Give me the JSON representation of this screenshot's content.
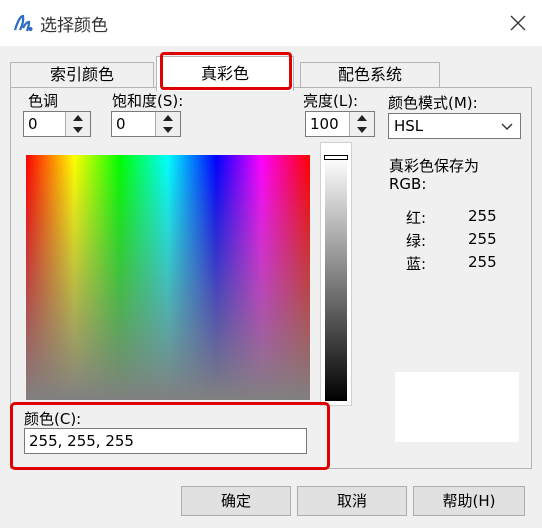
{
  "window": {
    "title": "选择颜色",
    "icon": "app-logo-icon",
    "close_icon": "close-icon"
  },
  "tabs": [
    {
      "label": "索引颜色"
    },
    {
      "label": "真彩色",
      "active": true
    },
    {
      "label": "配色系统"
    }
  ],
  "hsl": {
    "hue_label": "色调",
    "hue_value": "0",
    "saturation_label": "饱和度(S):",
    "saturation_value": "0",
    "brightness_label": "亮度(L):",
    "brightness_value": "100"
  },
  "color_mode": {
    "label": "颜色模式(M):",
    "selected": "HSL"
  },
  "save_as": {
    "line1": "真彩色保存为",
    "line2": "RGB:"
  },
  "rgb": [
    {
      "label": "红:",
      "value": "255"
    },
    {
      "label": "绿:",
      "value": "255"
    },
    {
      "label": "蓝:",
      "value": "255"
    }
  ],
  "color_field": {
    "label": "颜色(C):",
    "value": "255, 255, 255"
  },
  "buttons": {
    "ok": "确定",
    "cancel": "取消",
    "help": "帮助(H)"
  },
  "colors": {
    "highlight": "#e00000",
    "preview": "#ffffff",
    "background": "#f0f0f0"
  }
}
